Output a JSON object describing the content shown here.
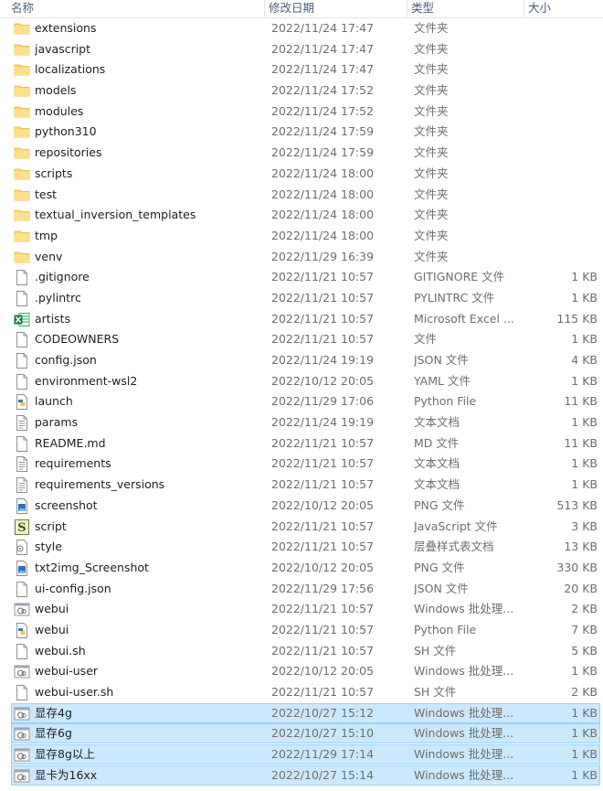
{
  "columns": {
    "name": "名称",
    "date": "修改日期",
    "type": "类型",
    "size": "大小"
  },
  "files": [
    {
      "name": "extensions",
      "date": "2022/11/24 17:47",
      "type": "文件夹",
      "size": "",
      "icon": "folder-icon"
    },
    {
      "name": "javascript",
      "date": "2022/11/24 17:47",
      "type": "文件夹",
      "size": "",
      "icon": "folder-icon"
    },
    {
      "name": "localizations",
      "date": "2022/11/24 17:47",
      "type": "文件夹",
      "size": "",
      "icon": "folder-icon"
    },
    {
      "name": "models",
      "date": "2022/11/24 17:52",
      "type": "文件夹",
      "size": "",
      "icon": "folder-icon"
    },
    {
      "name": "modules",
      "date": "2022/11/24 17:52",
      "type": "文件夹",
      "size": "",
      "icon": "folder-icon"
    },
    {
      "name": "python310",
      "date": "2022/11/24 17:59",
      "type": "文件夹",
      "size": "",
      "icon": "folder-icon"
    },
    {
      "name": "repositories",
      "date": "2022/11/24 17:59",
      "type": "文件夹",
      "size": "",
      "icon": "folder-icon"
    },
    {
      "name": "scripts",
      "date": "2022/11/24 18:00",
      "type": "文件夹",
      "size": "",
      "icon": "folder-icon"
    },
    {
      "name": "test",
      "date": "2022/11/24 18:00",
      "type": "文件夹",
      "size": "",
      "icon": "folder-icon"
    },
    {
      "name": "textual_inversion_templates",
      "date": "2022/11/24 18:00",
      "type": "文件夹",
      "size": "",
      "icon": "folder-icon"
    },
    {
      "name": "tmp",
      "date": "2022/11/24 18:00",
      "type": "文件夹",
      "size": "",
      "icon": "folder-icon"
    },
    {
      "name": "venv",
      "date": "2022/11/29 16:39",
      "type": "文件夹",
      "size": "",
      "icon": "folder-icon"
    },
    {
      "name": ".gitignore",
      "date": "2022/11/21 10:57",
      "type": "GITIGNORE 文件",
      "size": "1 KB",
      "icon": "file-icon"
    },
    {
      "name": ".pylintrc",
      "date": "2022/11/21 10:57",
      "type": "PYLINTRC 文件",
      "size": "1 KB",
      "icon": "file-icon"
    },
    {
      "name": "artists",
      "date": "2022/11/21 10:57",
      "type": "Microsoft Excel ...",
      "size": "115 KB",
      "icon": "excel-icon"
    },
    {
      "name": "CODEOWNERS",
      "date": "2022/11/21 10:57",
      "type": "文件",
      "size": "1 KB",
      "icon": "file-icon"
    },
    {
      "name": "config.json",
      "date": "2022/11/24 19:19",
      "type": "JSON 文件",
      "size": "4 KB",
      "icon": "file-icon"
    },
    {
      "name": "environment-wsl2",
      "date": "2022/10/12 20:05",
      "type": "YAML 文件",
      "size": "1 KB",
      "icon": "file-icon"
    },
    {
      "name": "launch",
      "date": "2022/11/29 17:06",
      "type": "Python File",
      "size": "11 KB",
      "icon": "python-icon"
    },
    {
      "name": "params",
      "date": "2022/11/24 19:19",
      "type": "文本文档",
      "size": "1 KB",
      "icon": "text-icon"
    },
    {
      "name": "README.md",
      "date": "2022/11/21 10:57",
      "type": "MD 文件",
      "size": "11 KB",
      "icon": "file-icon"
    },
    {
      "name": "requirements",
      "date": "2022/11/21 10:57",
      "type": "文本文档",
      "size": "1 KB",
      "icon": "text-icon"
    },
    {
      "name": "requirements_versions",
      "date": "2022/11/21 10:57",
      "type": "文本文档",
      "size": "1 KB",
      "icon": "text-icon"
    },
    {
      "name": "screenshot",
      "date": "2022/10/12 20:05",
      "type": "PNG 文件",
      "size": "513 KB",
      "icon": "image-icon"
    },
    {
      "name": "script",
      "date": "2022/11/21 10:57",
      "type": "JavaScript 文件",
      "size": "3 KB",
      "icon": "javascript-icon"
    },
    {
      "name": "style",
      "date": "2022/11/21 10:57",
      "type": "层叠样式表文档",
      "size": "13 KB",
      "icon": "css-icon"
    },
    {
      "name": "txt2img_Screenshot",
      "date": "2022/10/12 20:05",
      "type": "PNG 文件",
      "size": "330 KB",
      "icon": "image-icon"
    },
    {
      "name": "ui-config.json",
      "date": "2022/11/29 17:56",
      "type": "JSON 文件",
      "size": "20 KB",
      "icon": "file-icon"
    },
    {
      "name": "webui",
      "date": "2022/11/21 10:57",
      "type": "Windows 批处理...",
      "size": "2 KB",
      "icon": "batch-icon"
    },
    {
      "name": "webui",
      "date": "2022/11/21 10:57",
      "type": "Python File",
      "size": "7 KB",
      "icon": "python-icon"
    },
    {
      "name": "webui.sh",
      "date": "2022/11/21 10:57",
      "type": "SH 文件",
      "size": "5 KB",
      "icon": "file-icon"
    },
    {
      "name": "webui-user",
      "date": "2022/10/12 20:05",
      "type": "Windows 批处理...",
      "size": "1 KB",
      "icon": "batch-icon"
    },
    {
      "name": "webui-user.sh",
      "date": "2022/11/21 10:57",
      "type": "SH 文件",
      "size": "2 KB",
      "icon": "file-icon"
    },
    {
      "name": "显存4g",
      "date": "2022/10/27 15:12",
      "type": "Windows 批处理...",
      "size": "1 KB",
      "icon": "batch-icon",
      "selected": true
    },
    {
      "name": "显存6g",
      "date": "2022/10/27 15:10",
      "type": "Windows 批处理...",
      "size": "1 KB",
      "icon": "batch-icon",
      "selected": true
    },
    {
      "name": "显存8g以上",
      "date": "2022/11/29 17:14",
      "type": "Windows 批处理...",
      "size": "1 KB",
      "icon": "batch-icon",
      "selected": true
    },
    {
      "name": "显卡为16xx",
      "date": "2022/10/27 15:14",
      "type": "Windows 批处理...",
      "size": "1 KB",
      "icon": "batch-icon",
      "selected": true
    }
  ]
}
